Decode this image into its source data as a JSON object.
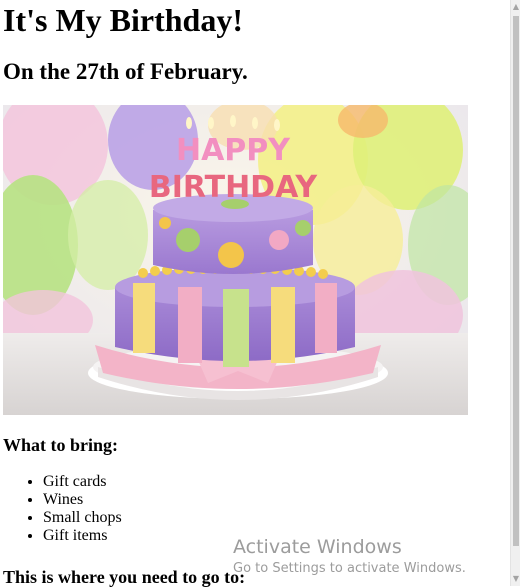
{
  "page": {
    "title": "It's My Birthday!",
    "subtitle": "On the 27th of February.",
    "image_alt": "Happy Birthday cake"
  },
  "bring": {
    "heading": "What to bring:",
    "items": [
      "Gift cards",
      "Wines",
      "Small chops",
      "Gift items"
    ]
  },
  "location": {
    "heading": "This is where you need to go to:"
  },
  "watermark": {
    "title": "Activate Windows",
    "subtitle": "Go to Settings to activate Windows."
  },
  "cake_text": {
    "happy": "HAPPY",
    "birthday": "BIRTHDAY"
  }
}
